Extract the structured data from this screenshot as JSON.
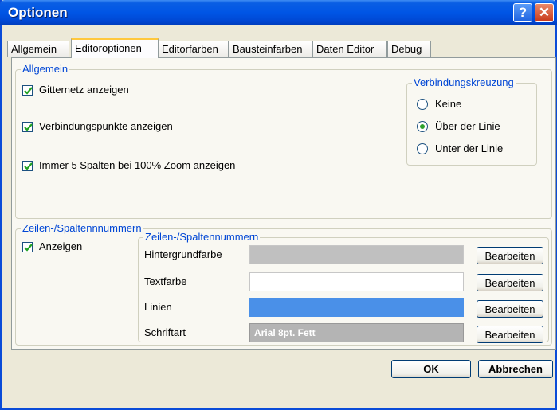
{
  "window": {
    "title": "Optionen",
    "help_label": "?",
    "close_label": "✕"
  },
  "tabs": [
    {
      "label": "Allgemein"
    },
    {
      "label": "Editoroptionen"
    },
    {
      "label": "Editorfarben"
    },
    {
      "label": "Bausteinfarben"
    },
    {
      "label": "Daten Editor"
    },
    {
      "label": "Debug"
    }
  ],
  "active_tab": "Editoroptionen",
  "allgemein": {
    "legend": "Allgemein",
    "checkboxes": [
      {
        "label": "Gitternetz anzeigen",
        "checked": true
      },
      {
        "label": "Verbindungspunkte anzeigen",
        "checked": true
      },
      {
        "label": "Immer 5 Spalten bei 100% Zoom anzeigen",
        "checked": true
      }
    ],
    "verbindungskreuzung": {
      "legend": "Verbindungskreuzung",
      "options": [
        {
          "label": "Keine",
          "selected": false
        },
        {
          "label": "Über der Linie",
          "selected": true
        },
        {
          "label": "Unter der Linie",
          "selected": false
        }
      ]
    }
  },
  "numbers": {
    "legend": "Zeilen-/Spaltennnummern",
    "show": {
      "label": "Anzeigen",
      "checked": true
    },
    "inner_legend": "Zeilen-/Spaltennummern",
    "rows": [
      {
        "label": "Hintergrundfarbe",
        "color": "#c0c0c0",
        "text": "",
        "button": "Bearbeiten"
      },
      {
        "label": "Textfarbe",
        "color": "#ffffff",
        "text": "",
        "button": "Bearbeiten"
      },
      {
        "label": "Linien",
        "color": "#4a90e8",
        "text": "",
        "button": "Bearbeiten"
      },
      {
        "label": "Schriftart",
        "color": "#b4b4b4",
        "text": "Arial 8pt. Fett",
        "button": "Bearbeiten"
      }
    ]
  },
  "footer": {
    "ok": "OK",
    "cancel": "Abbrechen"
  }
}
